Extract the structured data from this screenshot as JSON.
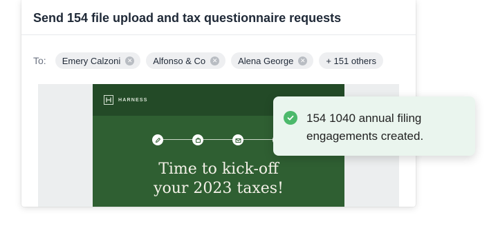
{
  "dialog": {
    "title": "Send 154 file upload and tax questionnaire requests"
  },
  "recipients": {
    "to_label": "To:",
    "chips": [
      "Emery Calzoni",
      "Alfonso & Co",
      "Alena George"
    ],
    "more_label": "+ 151 others"
  },
  "email_preview": {
    "brand": "HARNESS",
    "heading_line1": "Time to kick-off",
    "heading_line2": "your 2023 taxes!",
    "steps": [
      "pencil-icon",
      "file-icon",
      "envelope-icon",
      "check-icon"
    ],
    "colors": {
      "body": "#2f5f32",
      "header": "#234a27"
    }
  },
  "toast": {
    "line1": "154 1040 annual filing",
    "line2": "engagements created.",
    "icon": "check-circle-icon",
    "colors": {
      "background": "#eaf5ee",
      "icon": "#4cb96b"
    }
  }
}
